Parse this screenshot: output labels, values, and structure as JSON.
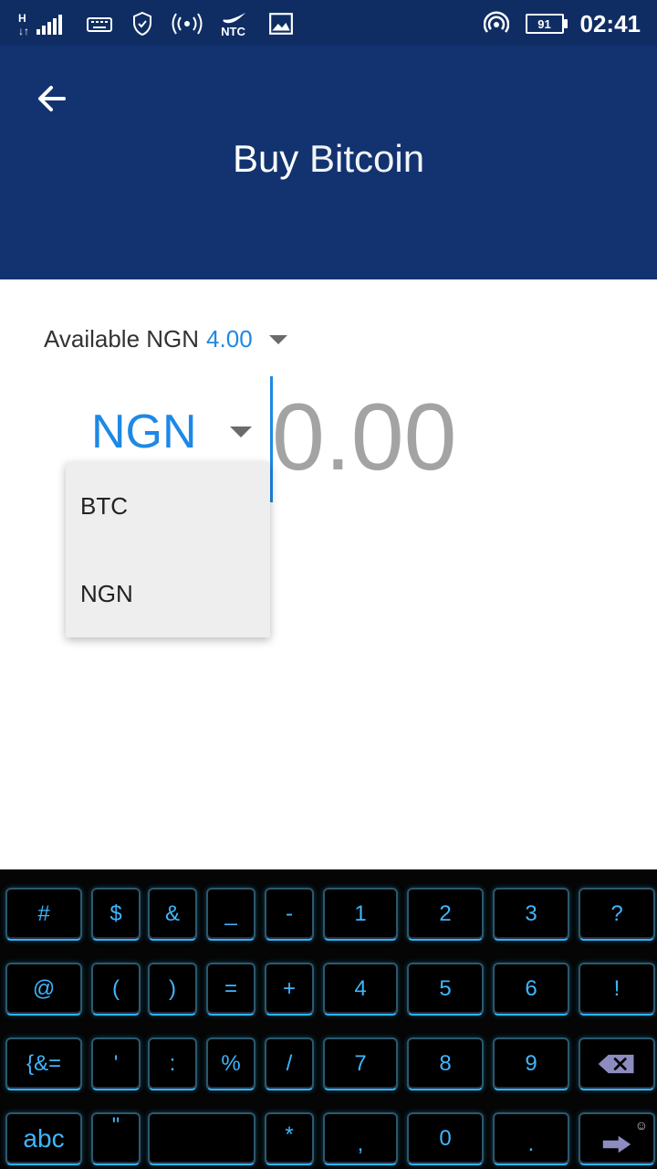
{
  "status_bar": {
    "network": "H",
    "carrier_badge": "NTC",
    "battery": "91",
    "time": "02:41"
  },
  "app_bar": {
    "title_bold": "Buy",
    "title_light": "Bitcoin"
  },
  "available": {
    "label": "Available NGN",
    "amount": "4.00"
  },
  "currency": {
    "selected": "NGN",
    "options": [
      "BTC",
      "NGN"
    ]
  },
  "amount_input": {
    "placeholder": "0.00",
    "value": ""
  },
  "keyboard": {
    "row1": [
      "#",
      "$",
      "&",
      "_",
      "-",
      "1",
      "2",
      "3",
      "?"
    ],
    "row2": [
      "@",
      "(",
      ")",
      "=",
      "+",
      "4",
      "5",
      "6",
      "!"
    ],
    "row3": [
      "{&=",
      "'",
      ":",
      "%",
      "/",
      "7",
      "8",
      "9"
    ],
    "row4": [
      "abc",
      "\"",
      "*",
      ",",
      "0",
      "."
    ],
    "emoji_hint": "☺"
  },
  "colors": {
    "app_bar": "#123370",
    "status_bar": "#0f2d63",
    "accent": "#1e88e5",
    "key_glow": "#29b6f6"
  }
}
